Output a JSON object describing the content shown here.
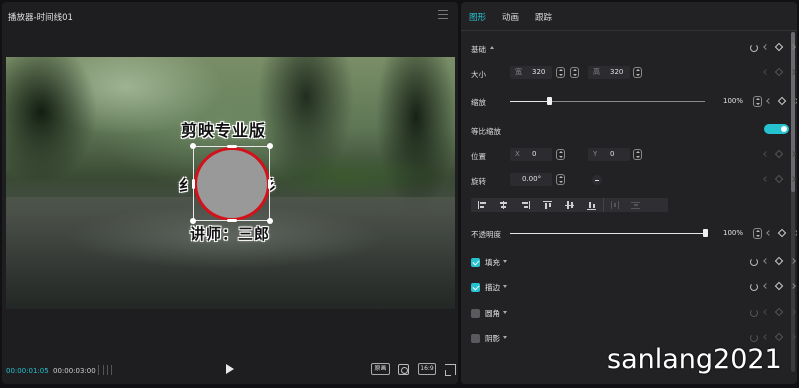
{
  "player": {
    "title": "播放器-时间线01",
    "captions": {
      "title": "剪映专业版",
      "left": "纟",
      "right": "彡",
      "teacher": "讲师：三郎"
    },
    "current_time": "00:00:01:05",
    "total_time": "00:00:03:00",
    "quality_label": "原画",
    "ratio_label": "16:9"
  },
  "inspector": {
    "tabs": [
      {
        "label": "图形",
        "active": true
      },
      {
        "label": "动画",
        "active": false
      },
      {
        "label": "跟踪",
        "active": false
      }
    ],
    "basic": {
      "label": "基础",
      "size_label": "大小",
      "width_prefix": "宽",
      "width_value": "320",
      "height_prefix": "高",
      "height_value": "320",
      "scale_label": "缩放",
      "scale_value": "100%",
      "scale_level": 0.2,
      "proportional_label": "等比缩放",
      "proportional_on": true,
      "position_label": "位置",
      "x_prefix": "X",
      "x_value": "0",
      "y_prefix": "Y",
      "y_value": "0",
      "rotation_label": "旋转",
      "rotation_value": "0.00°",
      "rotation_dial_label": "-",
      "opacity_label": "不透明度",
      "opacity_value": "100%",
      "opacity_level": 1.0
    },
    "sections": [
      {
        "label": "填充",
        "checked": true
      },
      {
        "label": "描边",
        "checked": true
      },
      {
        "label": "圆角",
        "checked": false
      },
      {
        "label": "阴影",
        "checked": false
      }
    ]
  },
  "watermark": "sanlang2021",
  "colors": {
    "accent": "#27c2d0",
    "stroke_red": "#d4111b",
    "shape_fill": "#999999"
  }
}
